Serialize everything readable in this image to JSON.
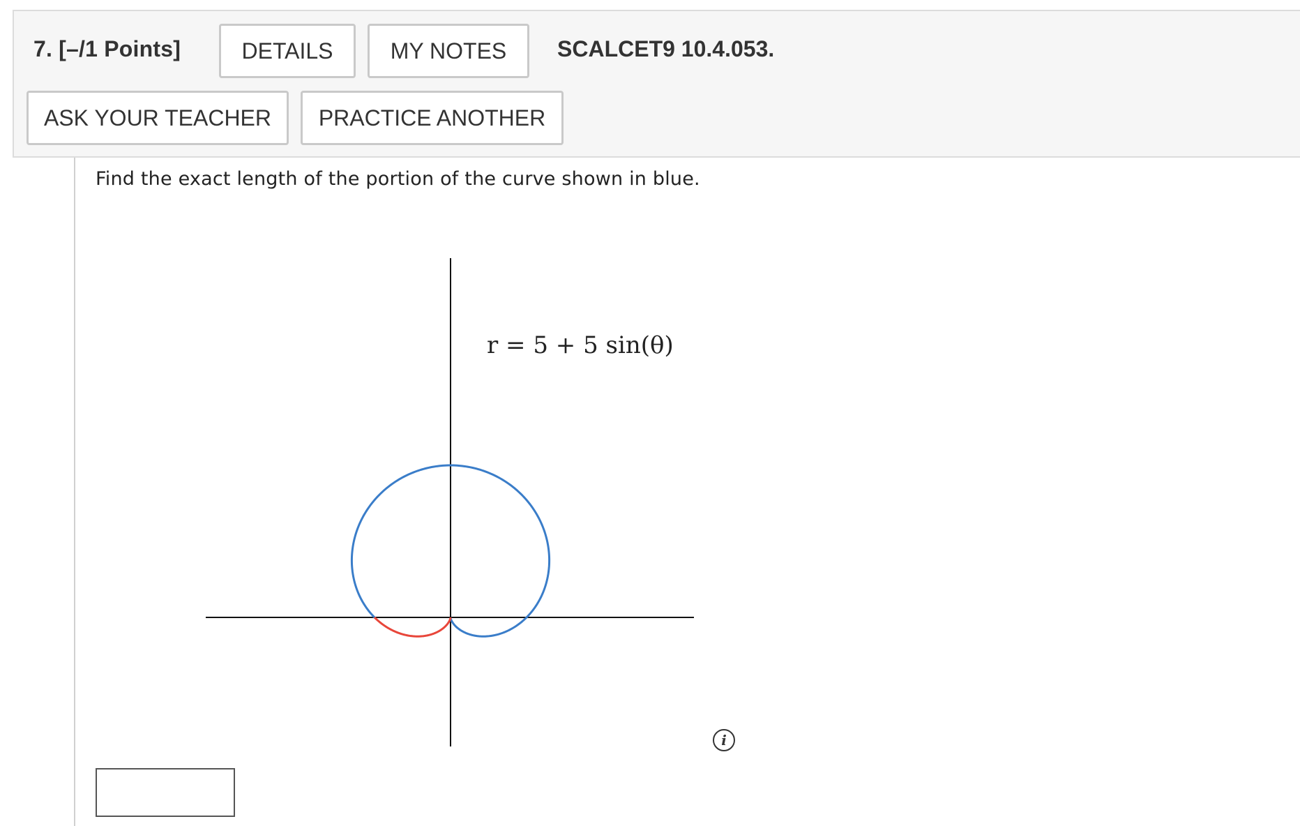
{
  "question": {
    "number_label": "7.  [–/1 Points]",
    "book_reference": "SCALCET9 10.4.053."
  },
  "buttons": {
    "details": "DETAILS",
    "my_notes": "MY NOTES",
    "ask_teacher": "ASK YOUR TEACHER",
    "practice_another": "PRACTICE ANOTHER"
  },
  "prompt_text": "Find the exact length of the portion of the curve shown in blue.",
  "figure": {
    "equation_label": "r = 5 + 5 sin(θ)",
    "colors": {
      "blue_curve": "#3a7dc9",
      "red_curve": "#e8463a",
      "axes": "#111111"
    }
  },
  "answer": {
    "value": "",
    "placeholder": ""
  },
  "icons": {
    "info": "info-icon"
  }
}
